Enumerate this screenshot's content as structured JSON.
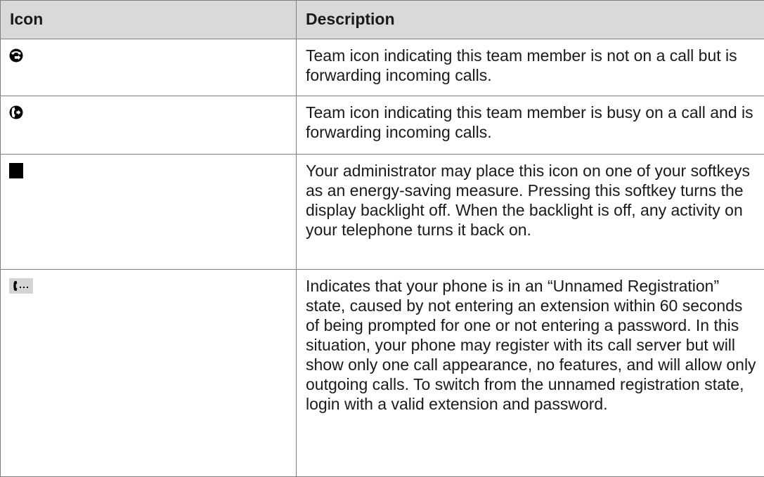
{
  "table": {
    "headers": {
      "icon": "Icon",
      "description": "Description"
    },
    "rows": [
      {
        "icon_name": "team-forwarding-icon",
        "description": "Team icon indicating this team member is not on a call but is forwarding incoming calls."
      },
      {
        "icon_name": "team-busy-forwarding-icon",
        "description": "Team icon indicating this team member is busy on a call and is forwarding incoming calls."
      },
      {
        "icon_name": "backlight-off-moon-icon",
        "description": "Your administrator may place this icon on one of your softkeys as an energy-saving measure. Pressing this softkey turns the display backlight off. When the backlight is off, any activity on your telephone turns it back on."
      },
      {
        "icon_name": "unnamed-registration-handset-icon",
        "description": "Indicates that your phone is in an “Unnamed Registration” state, caused by not entering an extension within 60 seconds of being prompted for one or not entering a password. In this situation, your phone may register with its call server but will show only one call appearance, no features, and will allow only outgoing calls. To switch from the unnamed registration state, login with a valid extension and password."
      }
    ]
  },
  "colors": {
    "header_background": "#d9d9d9",
    "border": "#7f7f7f",
    "text": "#1a1a1a"
  }
}
